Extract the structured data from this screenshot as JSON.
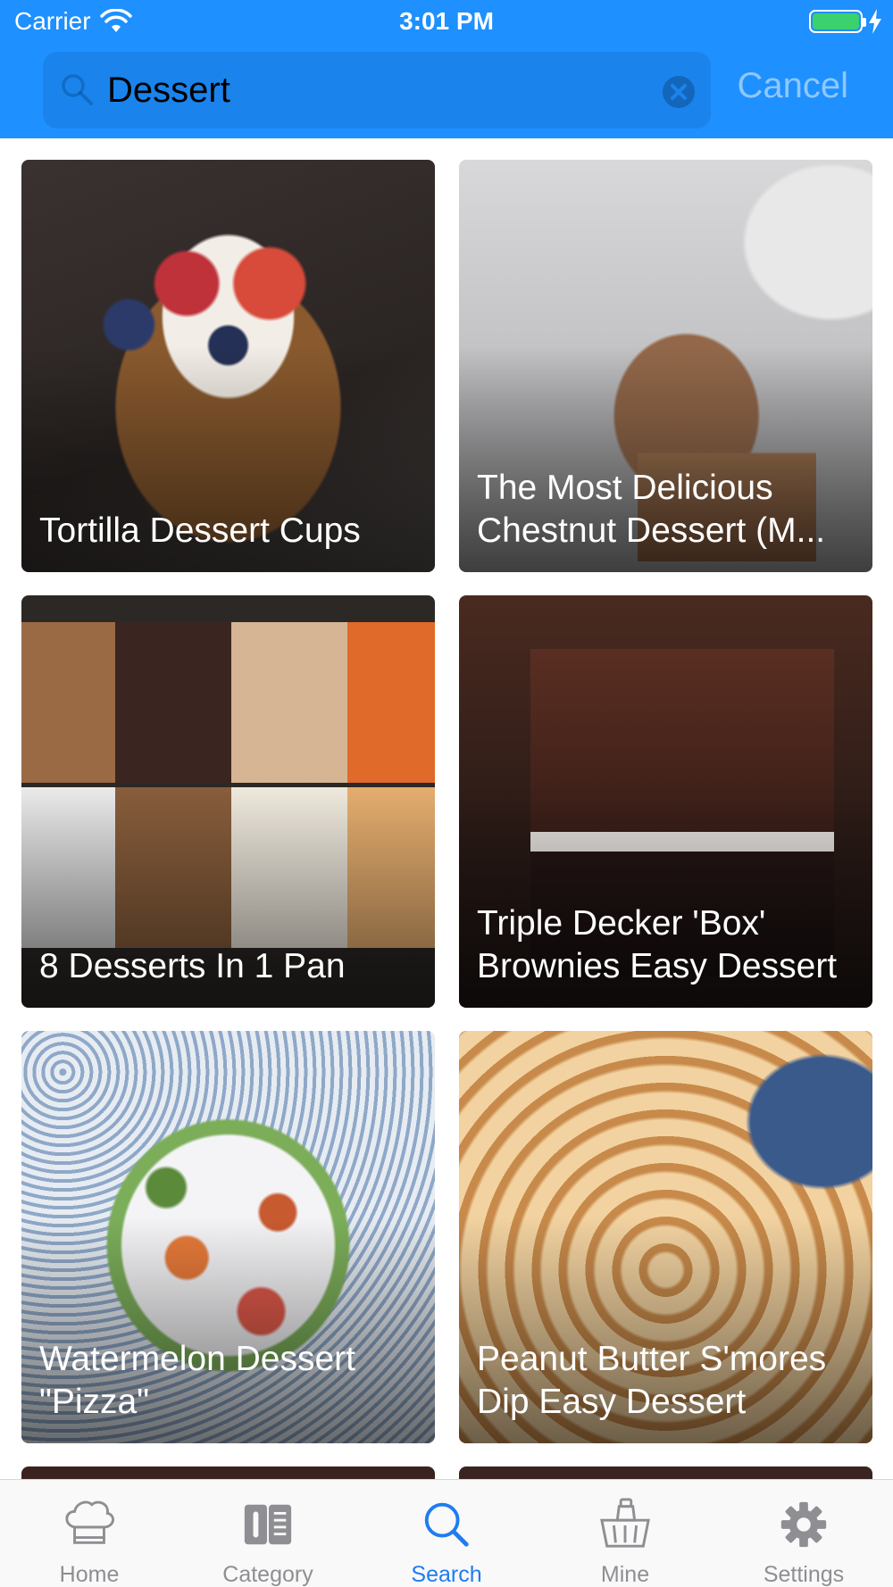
{
  "status_bar": {
    "carrier": "Carrier",
    "time": "3:01 PM"
  },
  "search": {
    "value": "Dessert",
    "placeholder": "",
    "cancel_label": "Cancel"
  },
  "results": [
    {
      "title": "Tortilla Dessert Cups"
    },
    {
      "title": "The Most Delicious\nChestnut Dessert (M..."
    },
    {
      "title": "8 Desserts In 1 Pan"
    },
    {
      "title": "Triple Decker 'Box'\nBrownies Easy Dessert"
    },
    {
      "title": "Watermelon Dessert\n\"Pizza\""
    },
    {
      "title": "Peanut Butter S'mores\nDip Easy Dessert"
    }
  ],
  "tabs": [
    {
      "label": "Home",
      "icon": "chef-hat-icon"
    },
    {
      "label": "Category",
      "icon": "book-icon"
    },
    {
      "label": "Search",
      "icon": "search-icon",
      "active": true
    },
    {
      "label": "Mine",
      "icon": "basket-icon"
    },
    {
      "label": "Settings",
      "icon": "gear-icon"
    }
  ],
  "colors": {
    "header": "#1e90ff",
    "active_tab": "#1e7cf0",
    "inactive_tab": "#8e8e93"
  }
}
